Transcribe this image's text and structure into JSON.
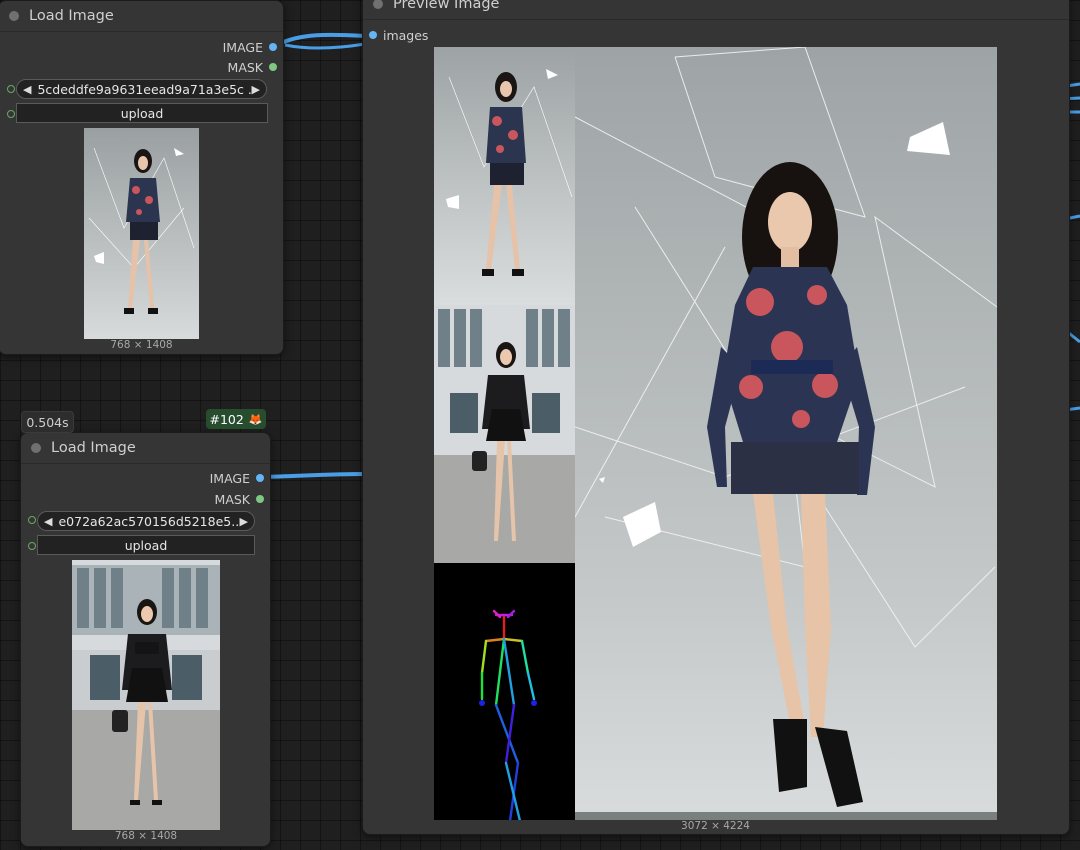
{
  "node1": {
    "title": "Load Image",
    "outputs": [
      "IMAGE",
      "MASK"
    ],
    "image_file": "5cdeddfe9a9631eead9a71a3e5c ...",
    "upload_label": "upload",
    "image_size": "768 × 1408"
  },
  "node2": {
    "title": "Load Image",
    "outputs": [
      "IMAGE",
      "MASK"
    ],
    "image_file": "e072a62ac570156d5218e5...",
    "upload_label": "upload",
    "image_size": "768 × 1408",
    "exec_time": "0.504s",
    "node_id": "#102"
  },
  "preview": {
    "title": "Preview Image",
    "input_label": "images",
    "image_size": "3072 × 4224"
  },
  "colors": {
    "image_port": "#64b5f6",
    "mask_port": "#81c784",
    "wire": "#4a9ee6",
    "node_bg": "#353535",
    "canvas_bg": "#1f1f1f",
    "id_badge": "#274d2f"
  },
  "icons": {
    "left_arrow": "◀",
    "right_arrow": "▶",
    "fox": "🦊"
  }
}
